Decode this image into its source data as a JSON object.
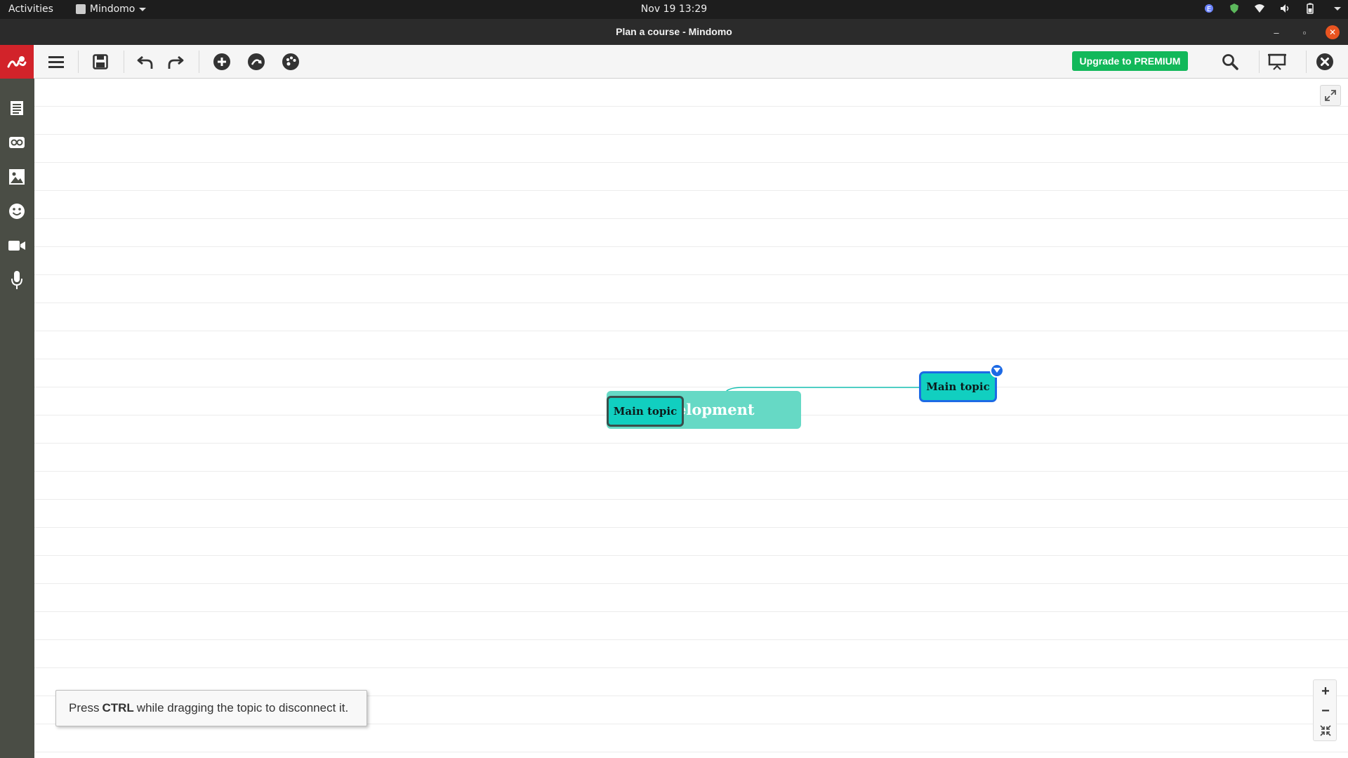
{
  "system_bar": {
    "activities": "Activities",
    "app_name": "Mindomo",
    "clock": "Nov 19  13:29"
  },
  "window": {
    "title": "Plan a course - Mindomo"
  },
  "toolbar": {
    "premium_label": "Upgrade to PREMIUM"
  },
  "mindmap": {
    "central_topic_visible_text": "elopment",
    "topics": [
      {
        "label": "Main topic"
      },
      {
        "label": "Main topic"
      }
    ]
  },
  "hint": {
    "before": "Press",
    "key": "CTRL",
    "after": "while dragging the topic to disconnect it."
  },
  "zoom": {
    "in": "+",
    "out": "−"
  },
  "colors": {
    "brand": "#d2232a",
    "premium": "#12b85a",
    "topic_fill": "#11cfc0",
    "central_fill": "#66d9c5",
    "selection": "#1d6ae5",
    "sidebar": "#4a4d45"
  }
}
